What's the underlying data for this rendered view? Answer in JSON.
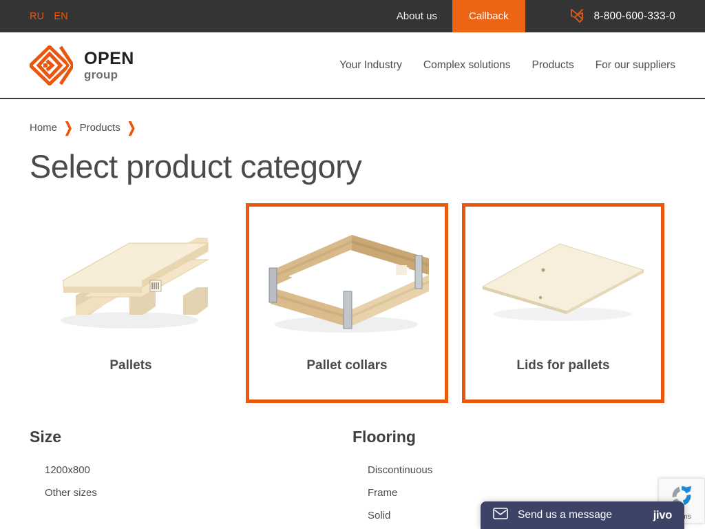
{
  "topbar": {
    "languages": [
      {
        "code": "RU",
        "active": false
      },
      {
        "code": "EN",
        "active": true
      }
    ],
    "about_label": "About us",
    "callback_label": "Callback",
    "phone": "8-800-600-333-0",
    "phone_icon": "phone-handset-icon",
    "bg_color": "#343434",
    "accent_color": "#ec6414"
  },
  "header": {
    "logo": {
      "mark_icon": "open-group-diamond-logo-icon",
      "name": "OPEN",
      "subtitle": "group"
    },
    "nav": [
      {
        "label": "Your Industry"
      },
      {
        "label": "Complex solutions"
      },
      {
        "label": "Products"
      },
      {
        "label": "For our suppliers"
      }
    ]
  },
  "breadcrumb": {
    "items": [
      {
        "label": "Home"
      },
      {
        "label": "Products"
      }
    ],
    "separator_icon": "chevron-right-icon"
  },
  "page": {
    "title": "Select product category"
  },
  "cards": [
    {
      "label": "Pallets",
      "image_icon": "wooden-pallet-image",
      "selected": false
    },
    {
      "label": "Pallet collars",
      "image_icon": "pallet-collar-image",
      "selected": true
    },
    {
      "label": "Lids for pallets",
      "image_icon": "pallet-lid-image",
      "selected": true
    }
  ],
  "filters": [
    {
      "title": "Size",
      "options": [
        "1200x800",
        "Other sizes"
      ]
    },
    {
      "title": "Flooring",
      "options": [
        "Discontinuous",
        "Frame",
        "Solid"
      ]
    }
  ],
  "chat_widget": {
    "icon": "envelope-icon",
    "text": "Send us a message",
    "brand": "jivo",
    "bg_color": "#3c4367"
  },
  "recaptcha": {
    "icon": "recaptcha-logo-icon",
    "terms_label": "Terms"
  }
}
